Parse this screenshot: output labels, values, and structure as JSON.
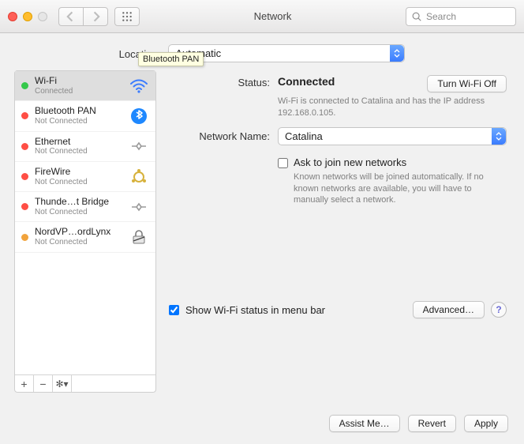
{
  "titlebar": {
    "title": "Network",
    "search_placeholder": "Search"
  },
  "location": {
    "label": "Location:",
    "value": "Automatic"
  },
  "sidebar": {
    "items": [
      {
        "name": "Wi-Fi",
        "sub": "Connected",
        "dot": "green",
        "icon": "wifi",
        "selected": true
      },
      {
        "name": "Bluetooth PAN",
        "sub": "Not Connected",
        "dot": "red",
        "icon": "bluetooth"
      },
      {
        "name": "Ethernet",
        "sub": "Not Connected",
        "dot": "red",
        "icon": "ethernet"
      },
      {
        "name": "FireWire",
        "sub": "Not Connected",
        "dot": "red",
        "icon": "firewire"
      },
      {
        "name": "Thunde…t Bridge",
        "sub": "Not Connected",
        "dot": "red",
        "icon": "ethernet"
      },
      {
        "name": "NordVP…ordLynx",
        "sub": "Not Connected",
        "dot": "orange",
        "icon": "lock"
      }
    ]
  },
  "tooltip": "Bluetooth PAN",
  "status": {
    "label": "Status:",
    "value": "Connected",
    "off_btn": "Turn Wi-Fi Off",
    "desc": "Wi-Fi is connected to Catalina and has the IP address 192.168.0.105."
  },
  "network_name": {
    "label": "Network Name:",
    "value": "Catalina"
  },
  "ask": {
    "label": "Ask to join new networks",
    "checked": false,
    "desc": "Known networks will be joined automatically. If no known networks are available, you will have to manually select a network."
  },
  "show_status": {
    "label": "Show Wi-Fi status in menu bar",
    "checked": true
  },
  "buttons": {
    "advanced": "Advanced…",
    "assist": "Assist Me…",
    "revert": "Revert",
    "apply": "Apply"
  }
}
